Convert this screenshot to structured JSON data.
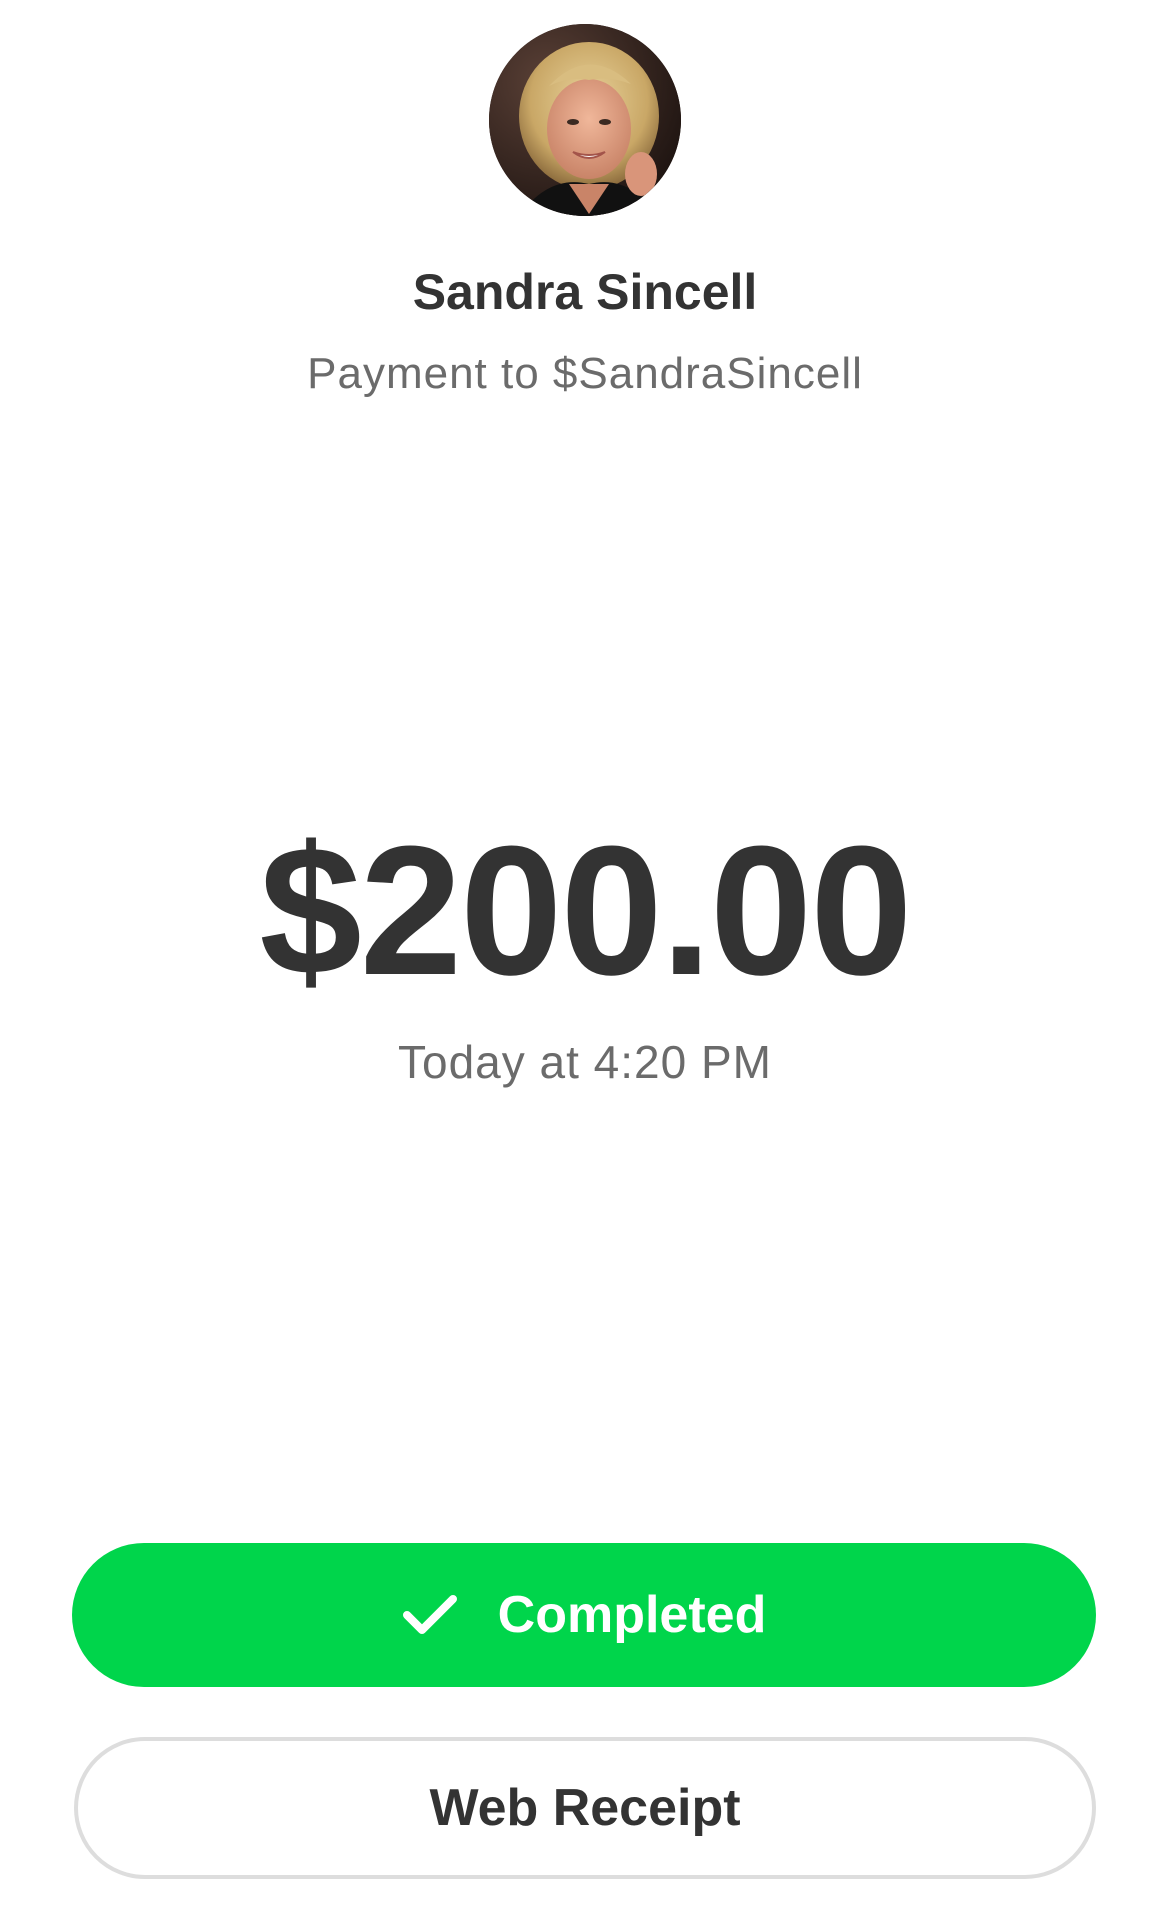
{
  "recipient": {
    "name": "Sandra Sincell",
    "subtitle": "Payment to $SandraSincell"
  },
  "payment": {
    "amount": "$200.00",
    "timestamp": "Today at 4:20 PM"
  },
  "status": {
    "label": "Completed",
    "icon": "checkmark-icon",
    "color": "#00d54b"
  },
  "actions": {
    "web_receipt_label": "Web Receipt"
  }
}
